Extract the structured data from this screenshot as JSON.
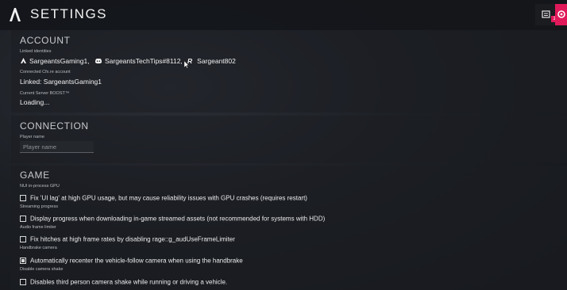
{
  "header": {
    "title": "SETTINGS",
    "notification_count": "1"
  },
  "account": {
    "title": "ACCOUNT",
    "linked_identities_label": "Linked identities",
    "identities": [
      {
        "icon": "steam-icon",
        "name": "SargeantsGaming1,"
      },
      {
        "icon": "discord-icon",
        "name": "SargeantsTechTips#8112,"
      },
      {
        "icon": "rockstar-icon",
        "name": "Sargeant802"
      }
    ],
    "cfx_label": "Connected Cfx.re account",
    "cfx_value": "Linked: SargeantsGaming1",
    "boost_label": "Current Server BOOST™",
    "boost_value": "Loading..."
  },
  "connection": {
    "title": "CONNECTION",
    "player_name_label": "Player name",
    "player_name_placeholder": "Player name",
    "player_name_value": ""
  },
  "game": {
    "title": "GAME",
    "options": [
      {
        "label": "NUI in-process GPU",
        "text": "Fix 'UI lag' at high GPU usage, but may cause reliability issues with GPU crashes (requires restart)",
        "checked": false
      },
      {
        "label": "Streaming progress",
        "text": "Display progress when downloading in-game streamed assets (not recommended for systems with HDD)",
        "checked": false
      },
      {
        "label": "Audio frame limiter",
        "text": "Fix hitches at high frame rates by disabling rage::g_audUseFrameLimiter",
        "checked": false
      },
      {
        "label": "Handbrake camera",
        "text": "Automatically recenter the vehicle-follow camera when using the handbrake",
        "checked": true
      },
      {
        "label": "Disable camera shake",
        "text": "Disables third person camera shake while running or driving a vehicle.",
        "checked": false
      }
    ]
  },
  "colors": {
    "accent": "#e0195a"
  }
}
